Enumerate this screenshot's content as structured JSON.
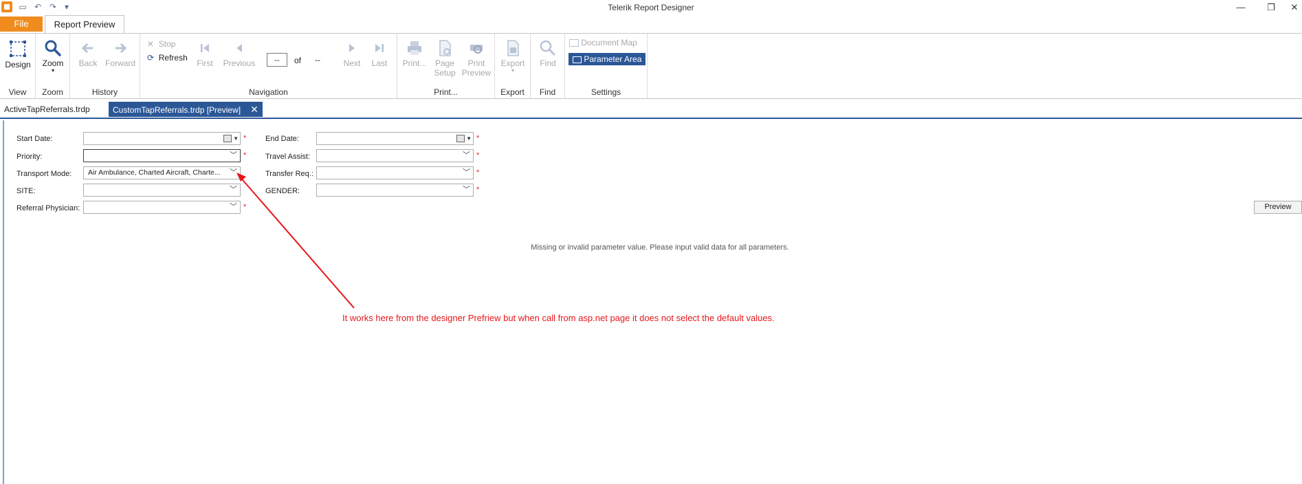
{
  "window": {
    "title": "Telerik Report Designer",
    "minimize": "—",
    "restore": "❐",
    "close": "✕"
  },
  "quick_access": [
    "save-icon",
    "undo-icon",
    "redo-icon",
    "customize-icon"
  ],
  "ribbon_tabs": {
    "file": "File",
    "report_preview": "Report Preview"
  },
  "ribbon": {
    "view": {
      "label": "View",
      "design": "Design"
    },
    "zoom": {
      "label": "Zoom",
      "zoom": "Zoom"
    },
    "history": {
      "label": "History",
      "back": "Back",
      "forward": "Forward"
    },
    "navigation": {
      "label": "Navigation",
      "stop": "Stop",
      "refresh": "Refresh",
      "first": "First",
      "previous": "Previous",
      "page_value": "--",
      "of": "of",
      "total": "--",
      "next": "Next",
      "last": "Last"
    },
    "print": {
      "label": "Print...",
      "print": "Print...",
      "page_setup_1": "Page",
      "page_setup_2": "Setup",
      "print_preview_1": "Print",
      "print_preview_2": "Preview"
    },
    "export": {
      "label": "Export",
      "export": "Export"
    },
    "find": {
      "label": "Find",
      "find": "Find"
    },
    "settings": {
      "label": "Settings",
      "document_map": "Document Map",
      "parameter_area": "Parameter Area"
    }
  },
  "doc_tabs": {
    "tab1": "ActiveTapReferrals.trdp",
    "tab2": "CustomTapReferrals.trdp [Preview]",
    "close": "✕"
  },
  "parameters": {
    "start_date": "Start Date:",
    "end_date": "End Date:",
    "priority": "Priority:",
    "travel_assist": "Travel Assist:",
    "transport_mode": "Transport Mode:",
    "transport_mode_value": "Air Ambulance, Charted Aircraft, Charte...",
    "transfer_req": "Transfer Req.:",
    "site": "SITE:",
    "gender": "GENDER:",
    "referral_physician": "Referral Physician:",
    "required_marker": "*"
  },
  "preview_button": "Preview",
  "message": "Missing or invalid parameter value. Please input valid data for all parameters.",
  "annotation": {
    "text": "It works here from the designer Prefriew but when call from asp.net page it does not select the default values.",
    "color": "#e8161a"
  },
  "colors": {
    "file_tab": "#f08c1e",
    "accent": "#2b5797",
    "required": "#e02020"
  }
}
